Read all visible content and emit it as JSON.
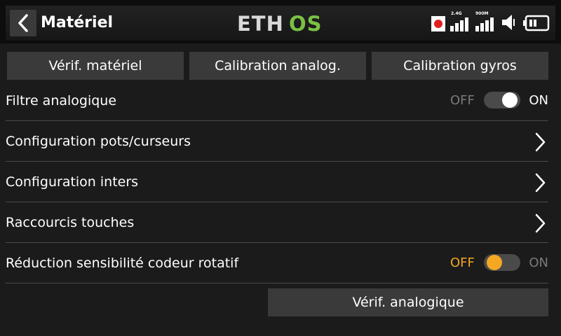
{
  "header": {
    "title": "Matériel",
    "logo_text": "ETHOS",
    "back_icon": "chevron-left-icon",
    "status": {
      "rec_icon": "record-icon",
      "signal1_label": "2.4G",
      "signal2_label": "900M",
      "speaker_icon": "speaker-icon",
      "battery_icon": "battery-icon"
    }
  },
  "tabs": [
    {
      "label": "Vérif. matériel"
    },
    {
      "label": "Calibration analog."
    },
    {
      "label": "Calibration gyros"
    }
  ],
  "rows": [
    {
      "label": "Filtre analogique",
      "off": "OFF",
      "on": "ON",
      "state": "on"
    },
    {
      "label": "Configuration pots/curseurs"
    },
    {
      "label": "Configuration inters"
    },
    {
      "label": "Raccourcis touches"
    },
    {
      "label": "Réduction sensibilité codeur rotatif",
      "off": "OFF",
      "on": "ON",
      "state": "off"
    }
  ],
  "footer_button": {
    "label": "Vérif. analogique"
  },
  "colors": {
    "accent_orange": "#f5a623",
    "logo_green": "#7ac143",
    "rec_red": "#e02020",
    "inactive_text": "#7a7a7a"
  }
}
